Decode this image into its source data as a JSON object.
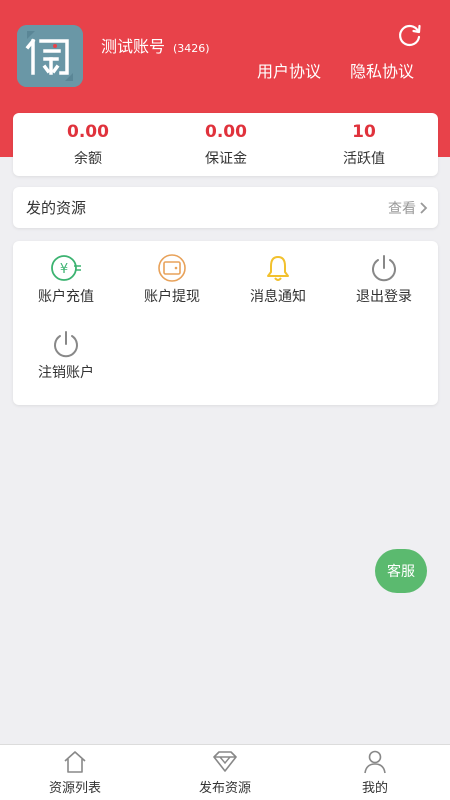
{
  "profile": {
    "name": "测试账号",
    "id": "(3426)",
    "avatar_icon": "app-logo-icon",
    "refresh_icon": "refresh-icon"
  },
  "links": {
    "user_agreement": "用户协议",
    "privacy_policy": "隐私协议"
  },
  "stats": [
    {
      "value": "0.00",
      "label": "余额"
    },
    {
      "value": "0.00",
      "label": "保证金"
    },
    {
      "value": "10",
      "label": "活跃值"
    }
  ],
  "resources": {
    "label": "发的资源",
    "view_label": "查看",
    "view_icon": "chevron-right-icon"
  },
  "menu": [
    {
      "label": "账户充值",
      "icon": "recharge-icon",
      "color": "#3cb371"
    },
    {
      "label": "账户提现",
      "icon": "wallet-icon",
      "color": "#e8a25a"
    },
    {
      "label": "消息通知",
      "icon": "bell-icon",
      "color": "#f2c12e"
    },
    {
      "label": "退出登录",
      "icon": "power-icon",
      "color": "#888888"
    },
    {
      "label": "注销账户",
      "icon": "power-icon",
      "color": "#888888"
    }
  ],
  "service_button": "客服",
  "tabbar": [
    {
      "label": "资源列表",
      "icon": "home-icon"
    },
    {
      "label": "发布资源",
      "icon": "diamond-icon"
    },
    {
      "label": "我的",
      "icon": "user-icon"
    }
  ],
  "colors": {
    "header": "#e8424a",
    "stat_value": "#e0323c",
    "service": "#5bba6f",
    "background": "#efeff2"
  }
}
